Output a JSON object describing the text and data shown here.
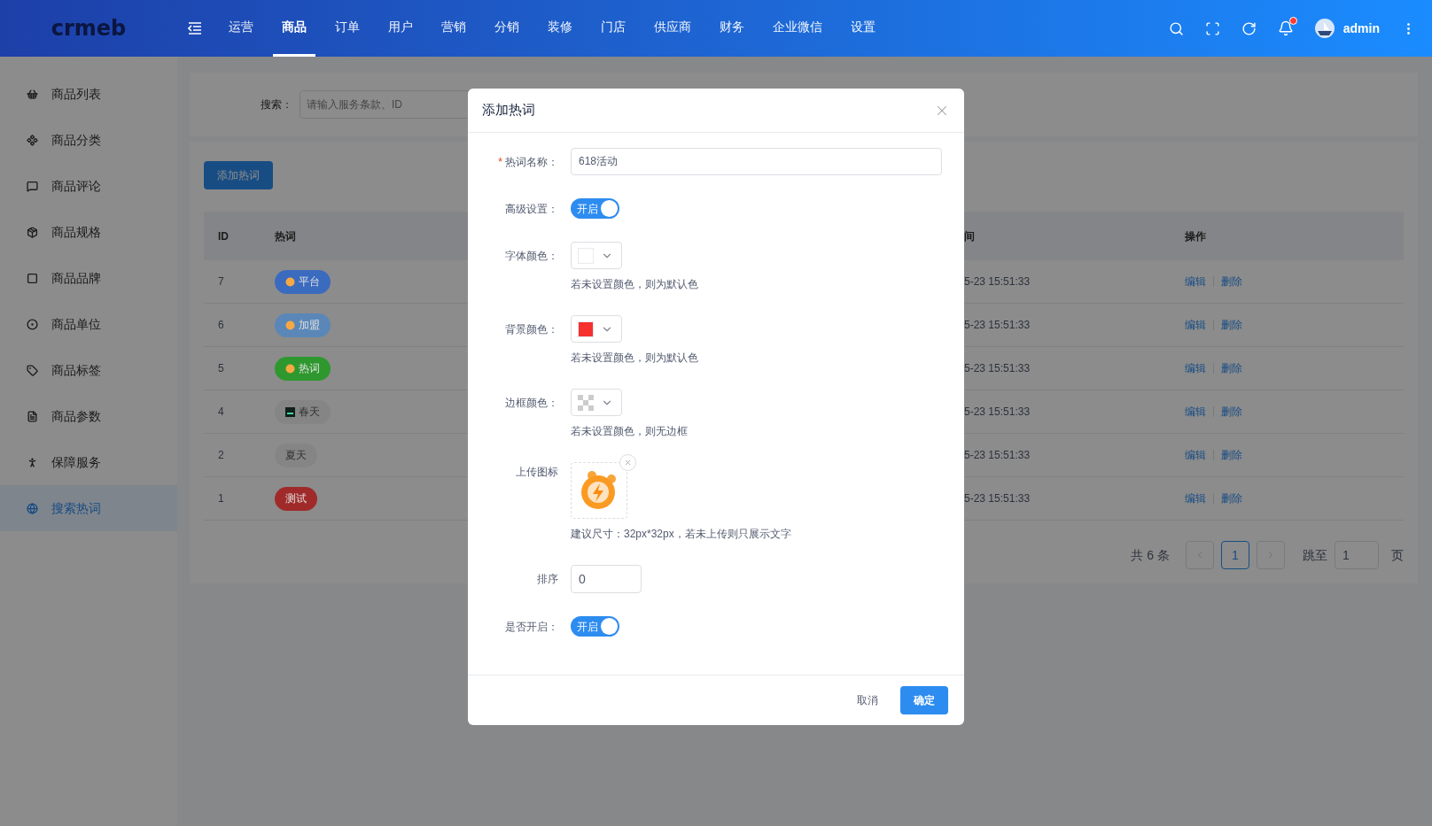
{
  "header": {
    "logo": "crmeb",
    "nav": [
      {
        "label": "运营",
        "selected": false
      },
      {
        "label": "商品",
        "selected": true
      },
      {
        "label": "订单",
        "selected": false
      },
      {
        "label": "用户",
        "selected": false
      },
      {
        "label": "营销",
        "selected": false
      },
      {
        "label": "分销",
        "selected": false
      },
      {
        "label": "装修",
        "selected": false
      },
      {
        "label": "门店",
        "selected": false
      },
      {
        "label": "供应商",
        "selected": false
      },
      {
        "label": "财务",
        "selected": false
      },
      {
        "label": "企业微信",
        "selected": false
      },
      {
        "label": "设置",
        "selected": false
      }
    ],
    "notification_dot": true,
    "user": "admin"
  },
  "sidebar": {
    "items": [
      {
        "label": "商品列表",
        "selected": false
      },
      {
        "label": "商品分类",
        "selected": false
      },
      {
        "label": "商品评论",
        "selected": false
      },
      {
        "label": "商品规格",
        "selected": false
      },
      {
        "label": "商品品牌",
        "selected": false
      },
      {
        "label": "商品单位",
        "selected": false
      },
      {
        "label": "商品标签",
        "selected": false
      },
      {
        "label": "商品参数",
        "selected": false
      },
      {
        "label": "保障服务",
        "selected": false
      },
      {
        "label": "搜索热词",
        "selected": true
      }
    ]
  },
  "search": {
    "label": "搜索：",
    "placeholder": "请输入服务条款、ID"
  },
  "add_button": "添加热词",
  "table": {
    "columns": [
      "ID",
      "热词",
      "间",
      "操作"
    ],
    "rows": [
      {
        "id": "7",
        "tag": {
          "text": "平台",
          "color": "#3a6bbf",
          "icon": true
        },
        "time": "5-23 15:51:33",
        "actions": [
          "编辑",
          "删除"
        ]
      },
      {
        "id": "6",
        "tag": {
          "text": "加盟",
          "color": "#5a87b8",
          "icon": true
        },
        "time": "5-23 15:51:33",
        "actions": [
          "编辑",
          "删除"
        ]
      },
      {
        "id": "5",
        "tag": {
          "text": "热词",
          "color": "#2e982e",
          "icon": true
        },
        "time": "5-23 15:51:33",
        "actions": [
          "编辑",
          "删除"
        ]
      },
      {
        "id": "4",
        "tag": {
          "text": "春天",
          "color": "#858585",
          "icon": true
        },
        "time": "5-23 15:51:33",
        "actions": [
          "编辑",
          "删除"
        ]
      },
      {
        "id": "2",
        "tag": {
          "text": "夏天",
          "color": "#858585",
          "icon": false
        },
        "time": "5-23 15:51:33",
        "actions": [
          "编辑",
          "删除"
        ]
      },
      {
        "id": "1",
        "tag": {
          "text": "测试",
          "color": "#a02a2a",
          "icon": false
        },
        "time": "5-23 15:51:33",
        "actions": [
          "编辑",
          "删除"
        ]
      }
    ]
  },
  "pagination": {
    "total": "共 6 条",
    "pages": [
      {
        "label": "1",
        "selected": true
      }
    ],
    "jump_label": "跳至",
    "jump_value": "1",
    "suffix": "页"
  },
  "dialog": {
    "title": "添加热词",
    "fields": [
      {
        "kind": "text",
        "label": "热词名称：",
        "required_mark": "*",
        "value": "618活动"
      },
      {
        "kind": "switch",
        "label": "高级设置：",
        "on": true,
        "text": "开启"
      },
      {
        "kind": "color",
        "label": "字体颜色：",
        "color": "#ffffff",
        "hint": "若未设置颜色，则为默认色"
      },
      {
        "kind": "color",
        "label": "背景颜色：",
        "color": "#f5302e",
        "hint": "若未设置颜色，则为默认色"
      },
      {
        "kind": "color",
        "label": "边框颜色：",
        "hint": "若未设置颜色，则无边框"
      },
      {
        "kind": "upload",
        "label": "上传图标",
        "hint": "建议尺寸：32px*32px，若未上传则只展示文字"
      },
      {
        "kind": "number",
        "label": "排序",
        "value": "0"
      },
      {
        "kind": "switch",
        "label": "是否开启：",
        "on": true,
        "text": "开启"
      }
    ],
    "cancel": "取消",
    "confirm": "确定"
  }
}
